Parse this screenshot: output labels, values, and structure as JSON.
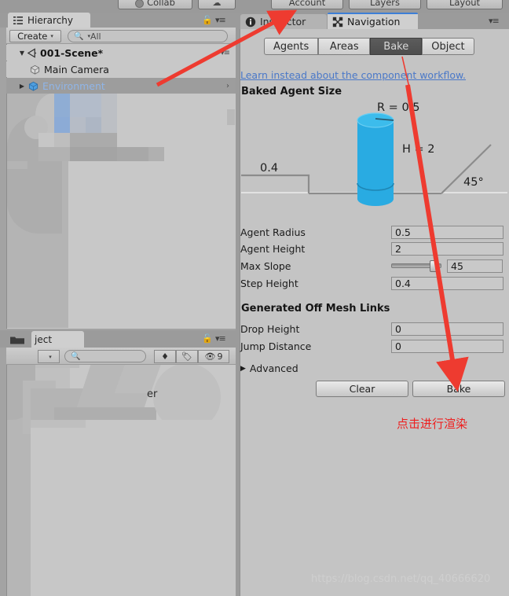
{
  "toolbar": {
    "collab_label": "Collab",
    "cloud_label": "☁",
    "account_label": "Account",
    "layers_label": "Layers",
    "layout_label": "Layout"
  },
  "hierarchy": {
    "tab_label": "Hierarchy",
    "create_label": "Create",
    "create_caret": "▾",
    "search_placeholder": "All",
    "search_value": "",
    "rows": [
      {
        "label": "001-Scene*",
        "type": "scene",
        "expanded": true,
        "selected": false
      },
      {
        "label": "Main Camera",
        "type": "gameobject",
        "expanded": false,
        "selected": false
      },
      {
        "label": "Environment",
        "type": "gameobject",
        "expanded": false,
        "selected": true
      }
    ]
  },
  "project": {
    "tab_label": "ject",
    "search_placeholder": "",
    "hidden_count": "9",
    "partial_text": "er"
  },
  "inspector": {
    "inspector_tab_label": "Inspector",
    "navigation_tab_label": "Navigation",
    "active_tab": "Navigation"
  },
  "navigation": {
    "tabs": [
      {
        "label": "Agents",
        "selected": false
      },
      {
        "label": "Areas",
        "selected": false
      },
      {
        "label": "Bake",
        "selected": true
      },
      {
        "label": "Object",
        "selected": false
      }
    ],
    "learn_link": "Learn instead about the component workflow.",
    "baked_agent_size_header": "Baked Agent Size",
    "diagram": {
      "radius_label": "R = 0.5",
      "height_label": "H = 2",
      "step_label": "0.4",
      "slope_label": "45°",
      "agent_color": "#29ABE2"
    },
    "fields": [
      {
        "label": "Agent Radius",
        "value": "0.5",
        "kind": "text"
      },
      {
        "label": "Agent Height",
        "value": "2",
        "kind": "text"
      },
      {
        "label": "Max Slope",
        "value": "45",
        "kind": "slider"
      },
      {
        "label": "Step Height",
        "value": "0.4",
        "kind": "text"
      }
    ],
    "generated_off_mesh_links_header": "Generated Off Mesh Links",
    "link_fields": [
      {
        "label": "Drop Height",
        "value": "0",
        "kind": "text"
      },
      {
        "label": "Jump Distance",
        "value": "0",
        "kind": "text"
      }
    ],
    "advanced_label": "Advanced",
    "advanced_caret": "▶",
    "clear_button": "Clear",
    "bake_button": "Bake"
  },
  "annotation": {
    "chinese_note": "点击进行渲染",
    "arrow_color": "#ee3b30"
  },
  "watermark": {
    "text": "https://blog.csdn.net/qq_40666620"
  },
  "colors": {
    "panel_bg": "#C4C4C4",
    "chrome_bg": "#9B9B9B",
    "selection_bg": "#9D9D9D",
    "link_blue": "#4A78C8",
    "tab_accent": "#3D7FD6"
  }
}
